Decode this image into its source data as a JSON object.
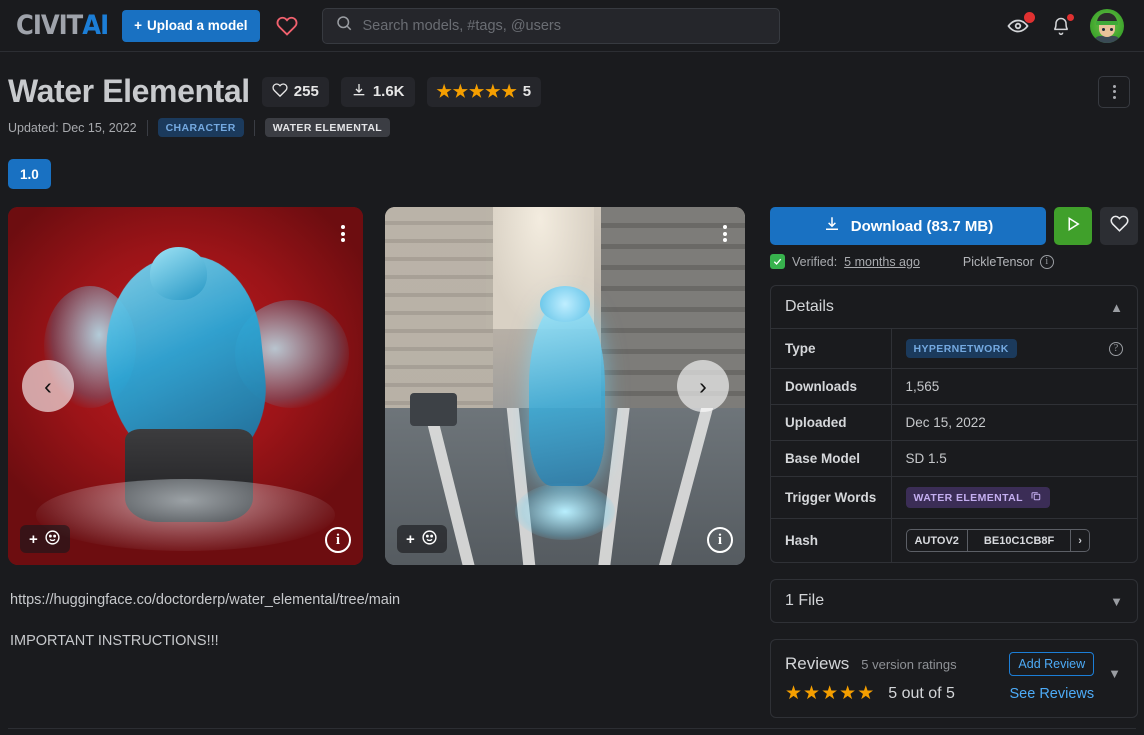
{
  "header": {
    "logo_civit": "CIVIT",
    "logo_ai": "AI",
    "upload_label": "Upload a model",
    "search_placeholder": "Search models, #tags, @users",
    "search_value": ""
  },
  "model": {
    "title": "Water Elemental",
    "likes": "255",
    "downloads_short": "1.6K",
    "rating_count": "5",
    "updated_label": "Updated: Dec 15, 2022",
    "tags": [
      {
        "label": "CHARACTER",
        "style": "blue"
      },
      {
        "label": "WATER ELEMENTAL",
        "style": "gray"
      }
    ],
    "version_tab": "1.0"
  },
  "gallery": {
    "reaction_label": "+",
    "info_label": "i",
    "prev_arrow": "‹",
    "next_arrow": "›"
  },
  "description": {
    "line1": "https://huggingface.co/doctorderp/water_elemental/tree/main",
    "line2": "IMPORTANT INSTRUCTIONS!!!"
  },
  "sidebar": {
    "download_label": "Download (83.7 MB)",
    "verified_prefix": "Verified:",
    "verified_time": "5 months ago",
    "pickle_label": "PickleTensor",
    "details_title": "Details",
    "details_rows": [
      {
        "key": "Type",
        "value": "HYPERNETWORK",
        "kind": "badge-type"
      },
      {
        "key": "Downloads",
        "value": "1,565",
        "kind": "text"
      },
      {
        "key": "Uploaded",
        "value": "Dec 15, 2022",
        "kind": "text"
      },
      {
        "key": "Base Model",
        "value": "SD 1.5",
        "kind": "text"
      },
      {
        "key": "Trigger Words",
        "value": "WATER ELEMENTAL",
        "kind": "badge-trigger"
      },
      {
        "key": "Hash",
        "value": "BE10C1CB8F",
        "kind": "hash",
        "algo": "AUTOV2"
      }
    ],
    "files_title": "1 File",
    "reviews": {
      "title": "Reviews",
      "subtitle": "5 version ratings",
      "add_review": "Add Review",
      "score": "5 out of 5",
      "see_reviews": "See Reviews",
      "star_count": 5
    }
  },
  "colors": {
    "accent_blue": "#1971c2",
    "green": "#40a02b",
    "star_orange": "#f59f00",
    "link_blue": "#4dabf7",
    "bg": "#1a1b1e"
  }
}
